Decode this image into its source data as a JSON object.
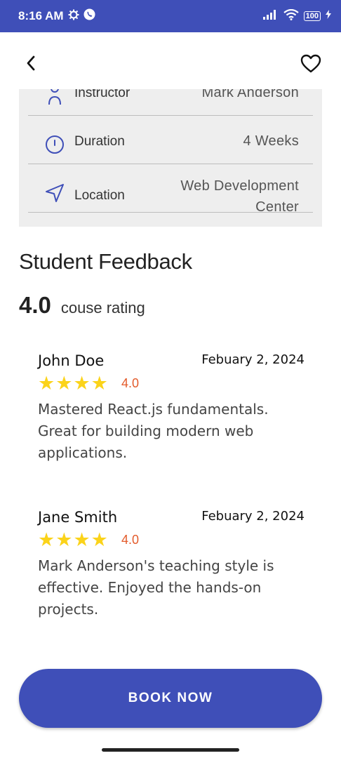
{
  "status_bar": {
    "time": "8:16 AM",
    "battery": "100"
  },
  "header": {
    "back_icon": "chevron-left-icon",
    "favorite_icon": "heart-outline-icon"
  },
  "course_info": [
    {
      "icon": "person-icon",
      "label": "Instructor",
      "value": "Mark Anderson"
    },
    {
      "icon": "clock-icon",
      "label": "Duration",
      "value": "4 Weeks"
    },
    {
      "icon": "location-arrow-icon",
      "label": "Location",
      "value_line1": "Web Development",
      "value_line2": "Center"
    }
  ],
  "feedback": {
    "title": "Student Feedback",
    "rating": "4.0",
    "rating_caption": "couse rating",
    "reviews": [
      {
        "name": "John Doe",
        "date": "Febuary 2, 2024",
        "stars": 4,
        "score": "4.0",
        "text": "Mastered React.js fundamentals. Great for building modern web applications."
      },
      {
        "name": "Jane Smith",
        "date": "Febuary 2, 2024",
        "stars": 4,
        "score": "4.0",
        "text": "Mark Anderson's teaching style is effective. Enjoyed the hands-on projects."
      }
    ]
  },
  "actions": {
    "book_now": "BOOK NOW"
  },
  "colors": {
    "primary": "#3f4fb8",
    "star": "#fbd31a",
    "score": "#e35b2b",
    "card_bg": "#eeeeee"
  }
}
